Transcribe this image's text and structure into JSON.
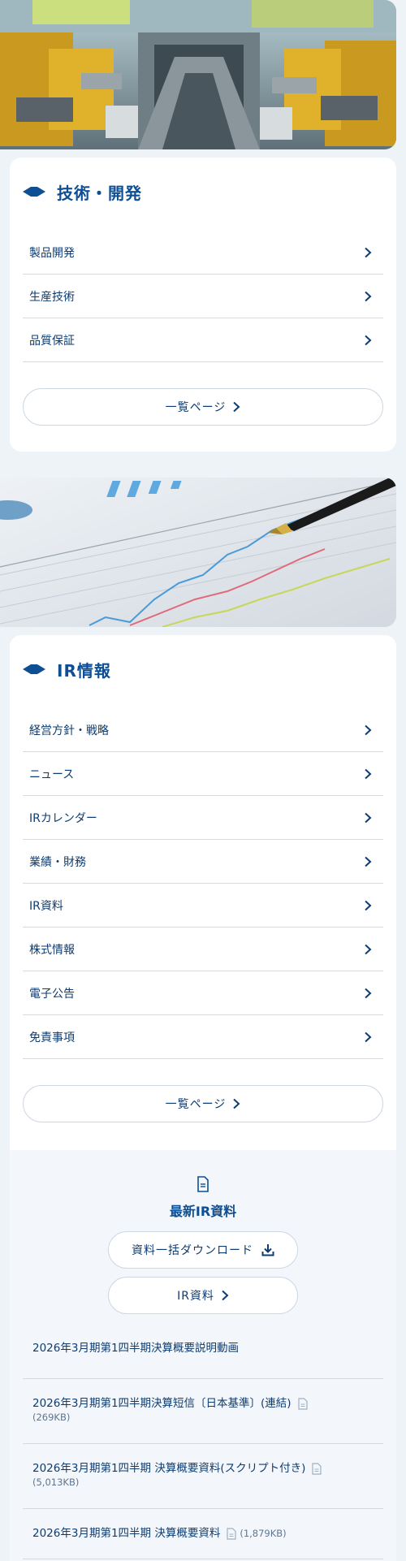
{
  "tech_section": {
    "title": "技術・開発",
    "items": [
      {
        "label": "製品開発"
      },
      {
        "label": "生産技術"
      },
      {
        "label": "品質保証"
      }
    ],
    "more_label": "一覧ページ"
  },
  "ir_section": {
    "title": "IR情報",
    "items": [
      {
        "label": "経営方針・戦略"
      },
      {
        "label": "ニュース"
      },
      {
        "label": "IRカレンダー"
      },
      {
        "label": "業績・財務"
      },
      {
        "label": "IR資料"
      },
      {
        "label": "株式情報"
      },
      {
        "label": "電子公告"
      },
      {
        "label": "免責事項"
      }
    ],
    "more_label": "一覧ページ"
  },
  "latest_ir": {
    "title": "最新IR資料",
    "bulk_download_label": "資料一括ダウンロード",
    "ir_docs_label": "IR資料",
    "documents": [
      {
        "title": "2026年3月期第1四半期決算概要説明動画"
      },
      {
        "title": "2026年3月期第1四半期決算短信〔日本基準〕(連結)",
        "size": "(269KB)"
      },
      {
        "title": "2026年3月期第1四半期 決算概要資料(スクリプト付き)",
        "size": "(5,013KB)"
      },
      {
        "title": "2026年3月期第1四半期 決算概要資料",
        "size": "(1,879KB)"
      }
    ]
  },
  "colors": {
    "accent": "#0e4f94",
    "text": "#0e3c70",
    "page_bg": "#eef3f8",
    "divider": "#d4dbe4"
  },
  "icons": {
    "section_marker": "diamond-chevron-icon",
    "row_arrow": "chevron-right-icon",
    "document": "document-icon",
    "download": "download-icon",
    "file": "file-icon"
  }
}
